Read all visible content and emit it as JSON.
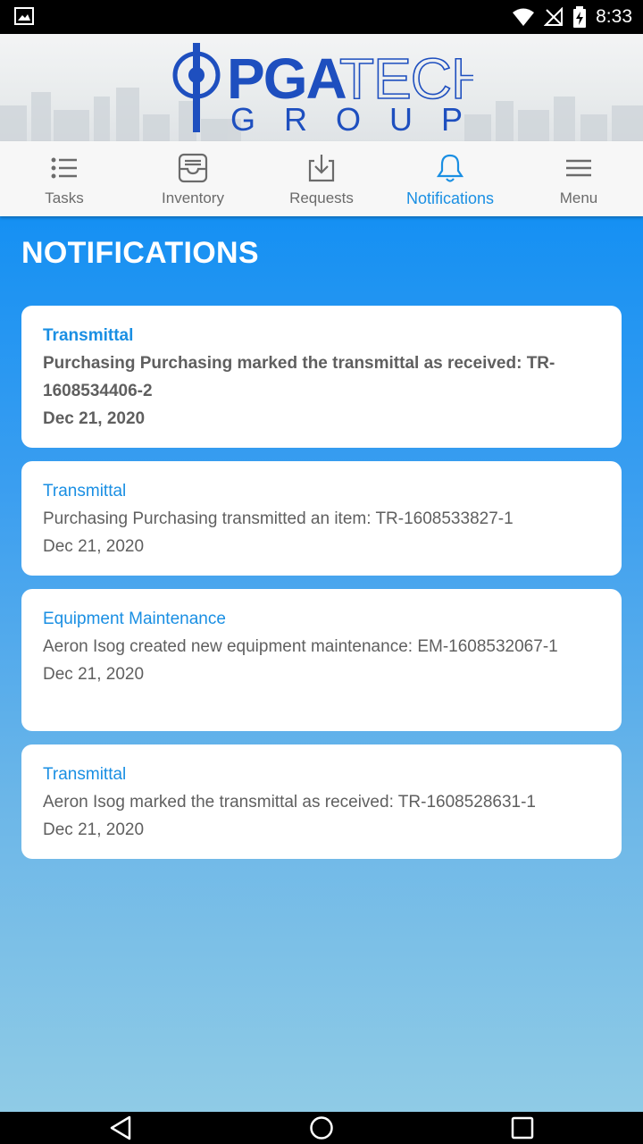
{
  "status_bar": {
    "time": "8:33",
    "icons": [
      "image-icon",
      "wifi-icon",
      "no-signal-icon",
      "battery-charging-icon"
    ]
  },
  "brand": {
    "pga": "PGA",
    "tech": "TECH",
    "group": "GROUP"
  },
  "tabs": [
    {
      "label": "Tasks",
      "icon": "list-icon",
      "active": false
    },
    {
      "label": "Inventory",
      "icon": "inbox-icon",
      "active": false
    },
    {
      "label": "Requests",
      "icon": "download-icon",
      "active": false
    },
    {
      "label": "Notifications",
      "icon": "bell-icon",
      "active": true
    },
    {
      "label": "Menu",
      "icon": "hamburger-icon",
      "active": false
    }
  ],
  "page": {
    "title": "NOTIFICATIONS"
  },
  "notifications": [
    {
      "type": "Transmittal",
      "message": "Purchasing Purchasing marked the transmittal as received: TR-1608534406-2",
      "date": "Dec 21, 2020",
      "unread": true
    },
    {
      "type": "Transmittal",
      "message": "Purchasing Purchasing transmitted an item: TR-1608533827-1",
      "date": "Dec 21, 2020",
      "unread": false
    },
    {
      "type": "Equipment Maintenance",
      "message": "Aeron Isog created new equipment maintenance: EM-1608532067-1",
      "date": "Dec 21, 2020",
      "unread": false
    },
    {
      "type": "Transmittal",
      "message": "Aeron Isog marked the transmittal as received: TR-1608528631-1",
      "date": "Dec 21, 2020",
      "unread": false
    }
  ],
  "colors": {
    "accent": "#1a8fe3",
    "brand_blue": "#1e4fbf",
    "background_top": "#1590f3",
    "background_bottom": "#8fcbe6"
  },
  "navbar": {
    "icons": [
      "back-icon",
      "home-icon",
      "recents-icon"
    ]
  }
}
